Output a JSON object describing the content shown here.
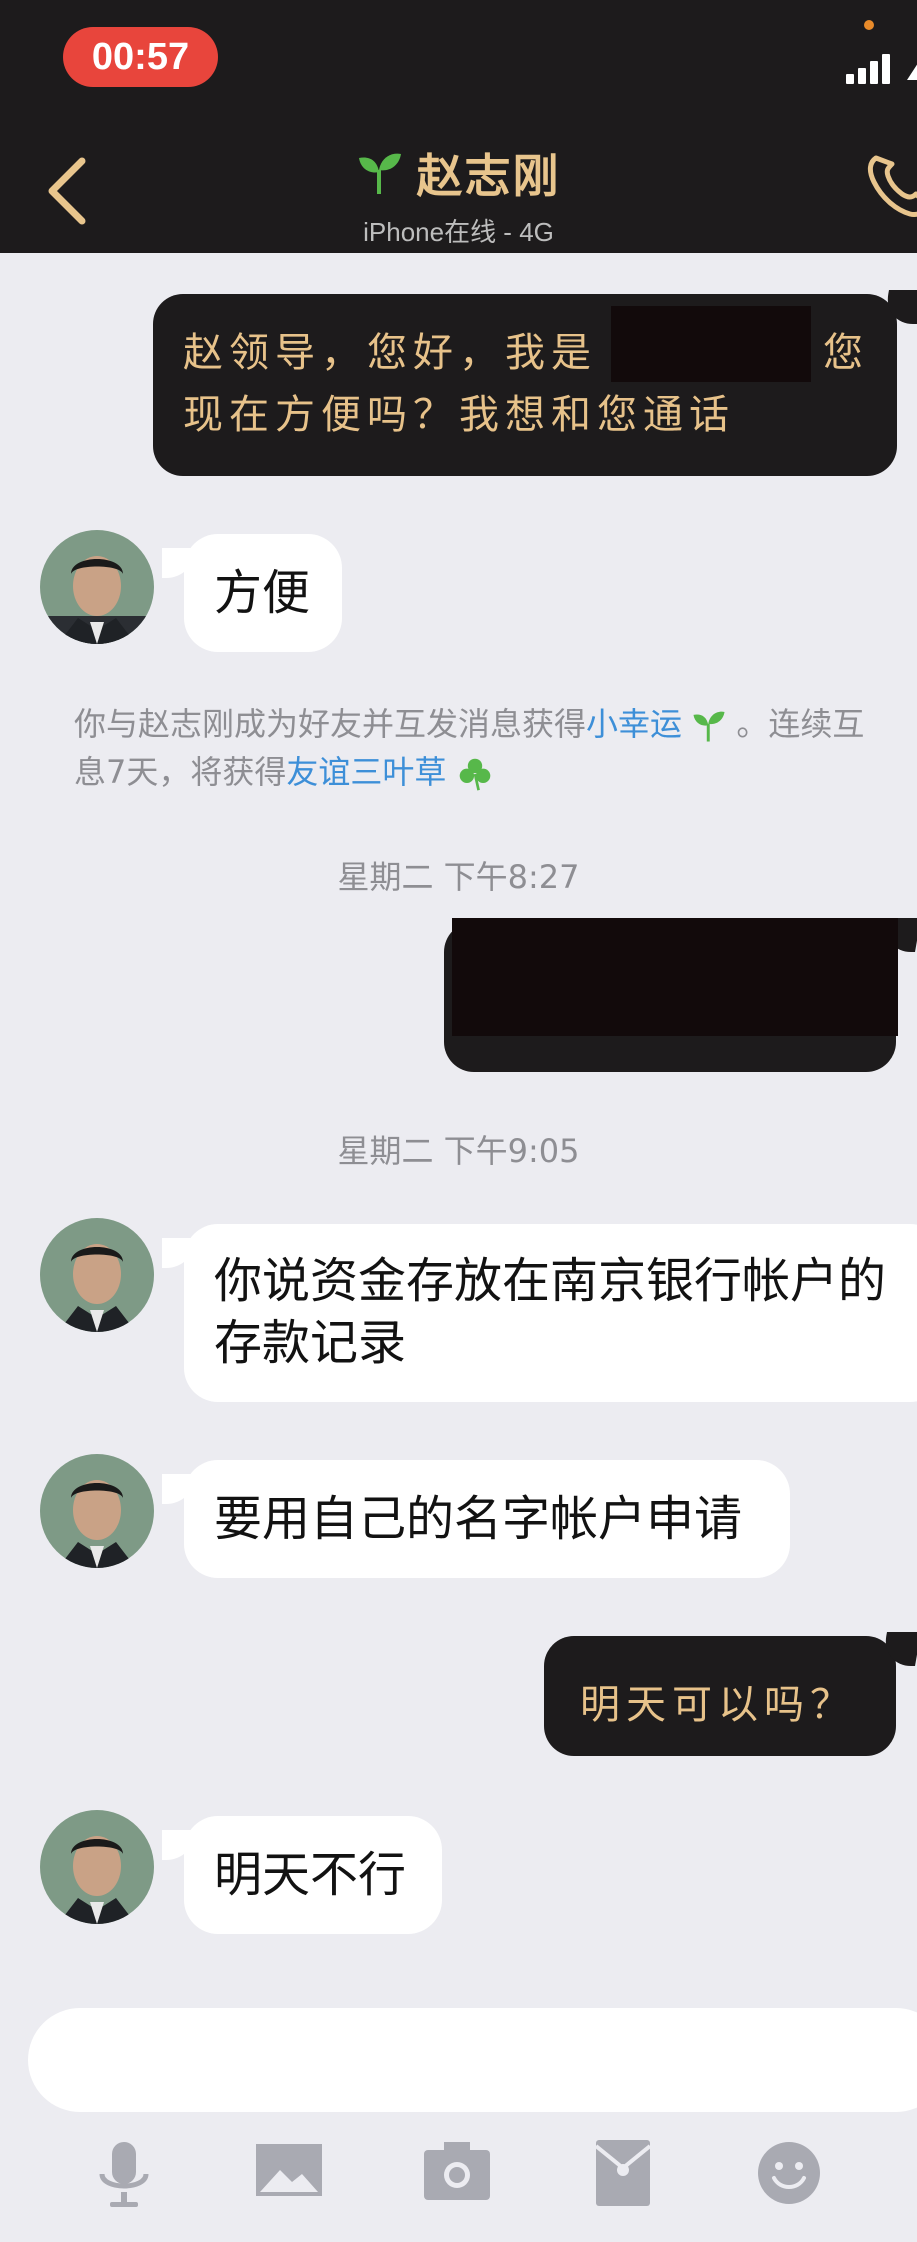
{
  "status_bar": {
    "time": "00:57"
  },
  "header": {
    "title": "赵志刚",
    "subtitle": "iPhone在线 - 4G",
    "icons": [
      "back-chevron-icon",
      "sprout-icon",
      "phone-icon"
    ]
  },
  "messages": {
    "m1": {
      "line1": "赵领导，您好，我是",
      "line1_tail": "您",
      "line2": "现在方便吗？我想和您通话"
    },
    "m2": {
      "text": "方便"
    },
    "m4": {
      "line1": "你说资金存放在南京银行帐户的",
      "line2": "存款记录"
    },
    "m5": {
      "text": "要用自己的名字帐户申请"
    },
    "m6": {
      "text": "明天可以吗？"
    },
    "m7": {
      "text": "明天不行"
    }
  },
  "system_message": {
    "part1": "你与赵志刚成为好友并互发消息获得",
    "link1": "小幸运",
    "part2": "。连续互",
    "part3": "息7天，将获得",
    "link2": "友谊三叶草"
  },
  "timestamps": {
    "t1": "星期二 下午8:27",
    "t2": "星期二 下午9:05"
  },
  "toolbar": {
    "icons": [
      "microphone-icon",
      "image-icon",
      "camera-icon",
      "red-packet-icon",
      "emoji-icon"
    ]
  },
  "colors": {
    "header_bg": "#1d1b1c",
    "accent_gold": "#e8c58d",
    "time_pill": "#e8453c",
    "link_blue": "#3d8fd8",
    "chat_bg": "#ececf1"
  }
}
